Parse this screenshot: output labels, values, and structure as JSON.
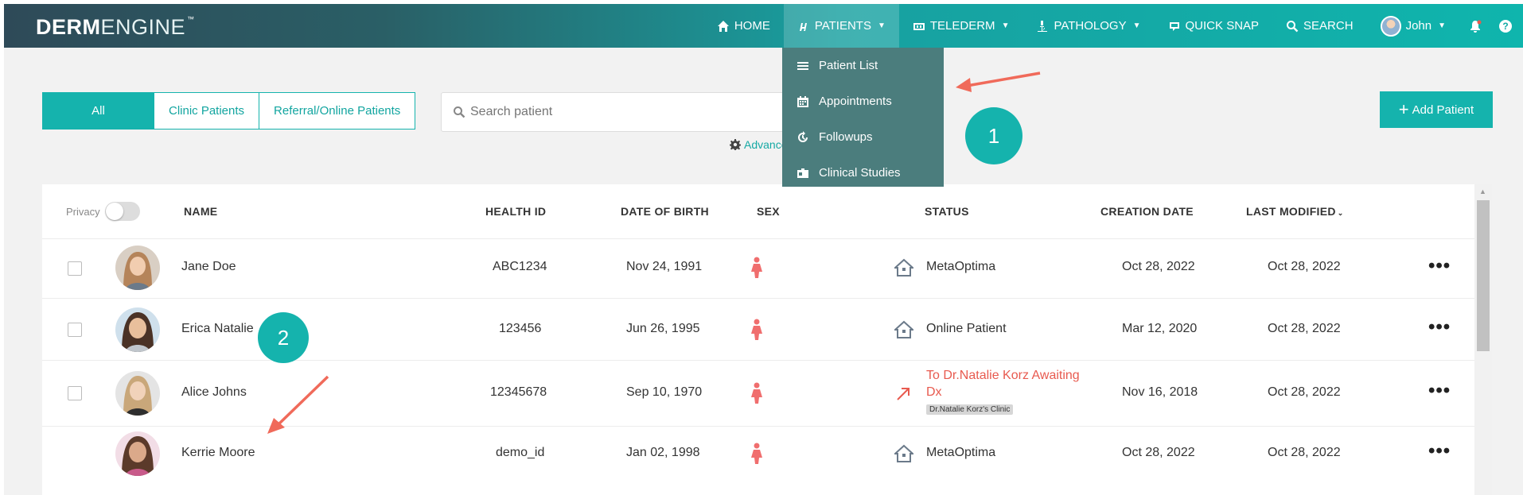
{
  "brand": {
    "logo_bold": "DERM",
    "logo_light": "ENGINE",
    "logo_tm": "™"
  },
  "nav": {
    "home": "HOME",
    "patients": "PATIENTS",
    "telederm": "TELEDERM",
    "pathology": "PATHOLOGY",
    "quick_snap": "QUICK SNAP",
    "search": "SEARCH",
    "user": "John",
    "help": "?"
  },
  "patients_menu": [
    "Patient List",
    "Appointments",
    "Followups",
    "Clinical Studies"
  ],
  "filters": [
    "All",
    "Clinic Patients",
    "Referral/Online Patients"
  ],
  "search": {
    "placeholder": "Search patient",
    "advanced": "Advanced"
  },
  "add_patient": "Add Patient",
  "table": {
    "privacy": "Privacy",
    "headers": {
      "name": "NAME",
      "health_id": "HEALTH ID",
      "dob": "DATE OF BIRTH",
      "sex": "SEX",
      "status": "STATUS",
      "creation": "CREATION DATE",
      "modified": "LAST MODIFIED"
    },
    "rows": [
      {
        "name": "Jane Doe",
        "health_id": "ABC1234",
        "dob": "Nov 24, 1991",
        "status": "MetaOptima",
        "created": "Oct 28, 2022",
        "modified": "Oct 28, 2022"
      },
      {
        "name": "Erica Natalie",
        "health_id": "123456",
        "dob": "Jun 26, 1995",
        "status": "Online Patient",
        "created": "Mar 12, 2020",
        "modified": "Oct 28, 2022"
      },
      {
        "name": "Alice Johns",
        "health_id": "12345678",
        "dob": "Sep 10, 1970",
        "status_line1": "To Dr.Natalie Korz Awaiting",
        "status_line2": "Dx",
        "status_badge": "Dr.Natalie Korz's Clinic",
        "created": "Nov 16, 2018",
        "modified": "Oct 28, 2022"
      },
      {
        "name": "Kerrie Moore",
        "health_id": "demo_id",
        "dob": "Jan 02, 1998",
        "status": "MetaOptima",
        "created": "Oct 28, 2022",
        "modified": "Oct 28, 2022"
      }
    ]
  },
  "annotations": {
    "one": "1",
    "two": "2"
  },
  "colors": {
    "teal": "#15b3ad",
    "dropdown": "#4b7d7d",
    "alert": "#e85a4f"
  }
}
